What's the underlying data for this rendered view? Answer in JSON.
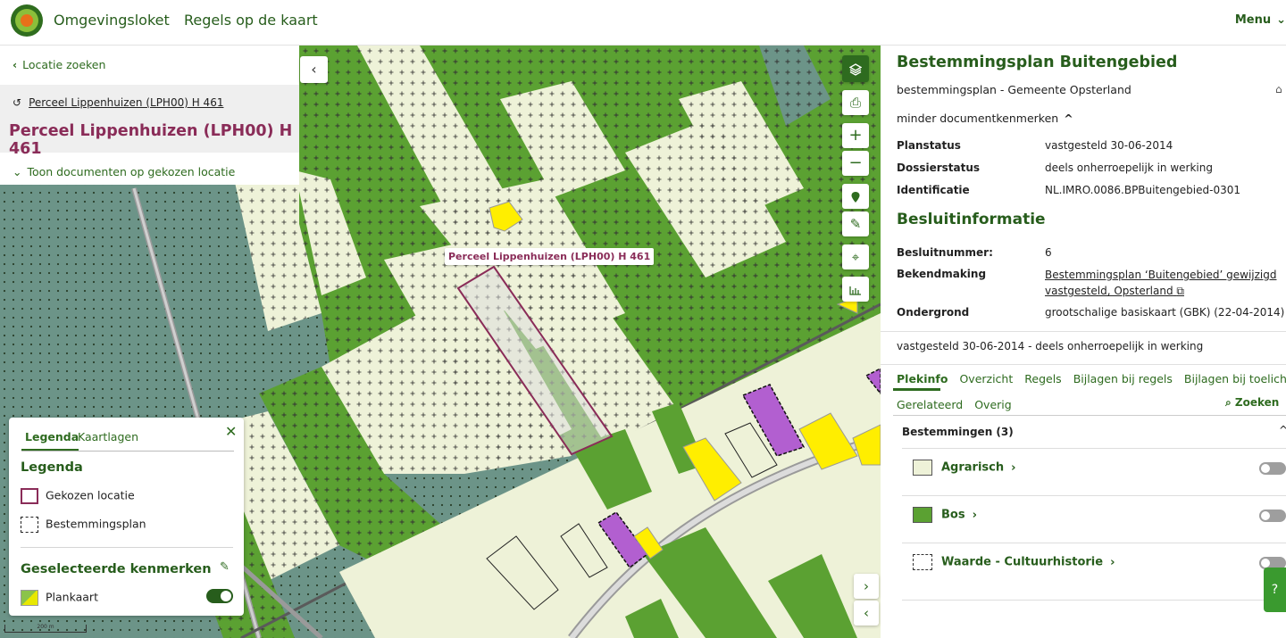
{
  "header": {
    "brand": "Omgevingsloket",
    "subtitle": "Regels op de kaart",
    "menu_label": "Menu"
  },
  "left_panel": {
    "back_label": "Locatie zoeken",
    "result_link": "Perceel Lippenhuizen (LPH00) H 461",
    "result_title": "Perceel Lippenhuizen (LPH00) H 461",
    "docs_toggle": "Toon documenten op gekozen locatie"
  },
  "map": {
    "parcel_label": "Perceel Lippenhuizen (LPH00) H 461",
    "scale_text": "200 m"
  },
  "legend": {
    "tabs": [
      "Legenda",
      "Kaartlagen"
    ],
    "title": "Legenda",
    "items": [
      {
        "label": "Gekozen locatie"
      },
      {
        "label": "Bestemmingsplan"
      }
    ],
    "selected_title": "Geselecteerde kenmerken",
    "selected_items": [
      {
        "label": "Plankaart",
        "enabled": true
      }
    ]
  },
  "right_panel": {
    "title": "Bestemmingsplan Buitengebied",
    "subtitle": "bestemmingsplan - Gemeente Opsterland",
    "toggle_label": "minder documentkenmerken",
    "properties": [
      {
        "key": "Planstatus",
        "value": "vastgesteld 30-06-2014"
      },
      {
        "key": "Dossierstatus",
        "value": "deels onherroepelijk in werking"
      },
      {
        "key": "Identificatie",
        "value": "NL.IMRO.0086.BPBuitengebied-0301"
      }
    ],
    "besluit_title": "Besluitinformatie",
    "besluit": [
      {
        "key": "Besluitnummer:",
        "value": "6"
      },
      {
        "key": "Bekendmaking",
        "value_line1": "Bestemmingsplan ‘Buitengebied’ gewijzigd",
        "value_line2": "vastgesteld, Opsterland"
      },
      {
        "key": "Ondergrond",
        "value": "grootschalige basiskaart (GBK) (22-04-2014)"
      }
    ],
    "status_text": "vastgesteld 30-06-2014 - deels onherroepelijk in werking",
    "tabs": [
      "Plekinfo",
      "Overzicht",
      "Regels",
      "Bijlagen bij regels",
      "Bijlagen bij toelichting"
    ],
    "tabs2": [
      "Gerelateerd",
      "Overig"
    ],
    "search_label": "Zoeken",
    "bestemmingen_header": "Bestemmingen (3)",
    "bestemmingen": [
      {
        "label": "Agrarisch",
        "color": "#eef2d8"
      },
      {
        "label": "Bos",
        "color": "#5ba132"
      },
      {
        "label": "Waarde - Cultuurhistorie",
        "color": "#ffffff"
      }
    ]
  },
  "colors": {
    "brand_green": "#275d1c",
    "parcel_purple": "#8a2c58",
    "agrarisch": "#eef2d8",
    "bos": "#5ba132",
    "natuur": "#6c9488"
  }
}
